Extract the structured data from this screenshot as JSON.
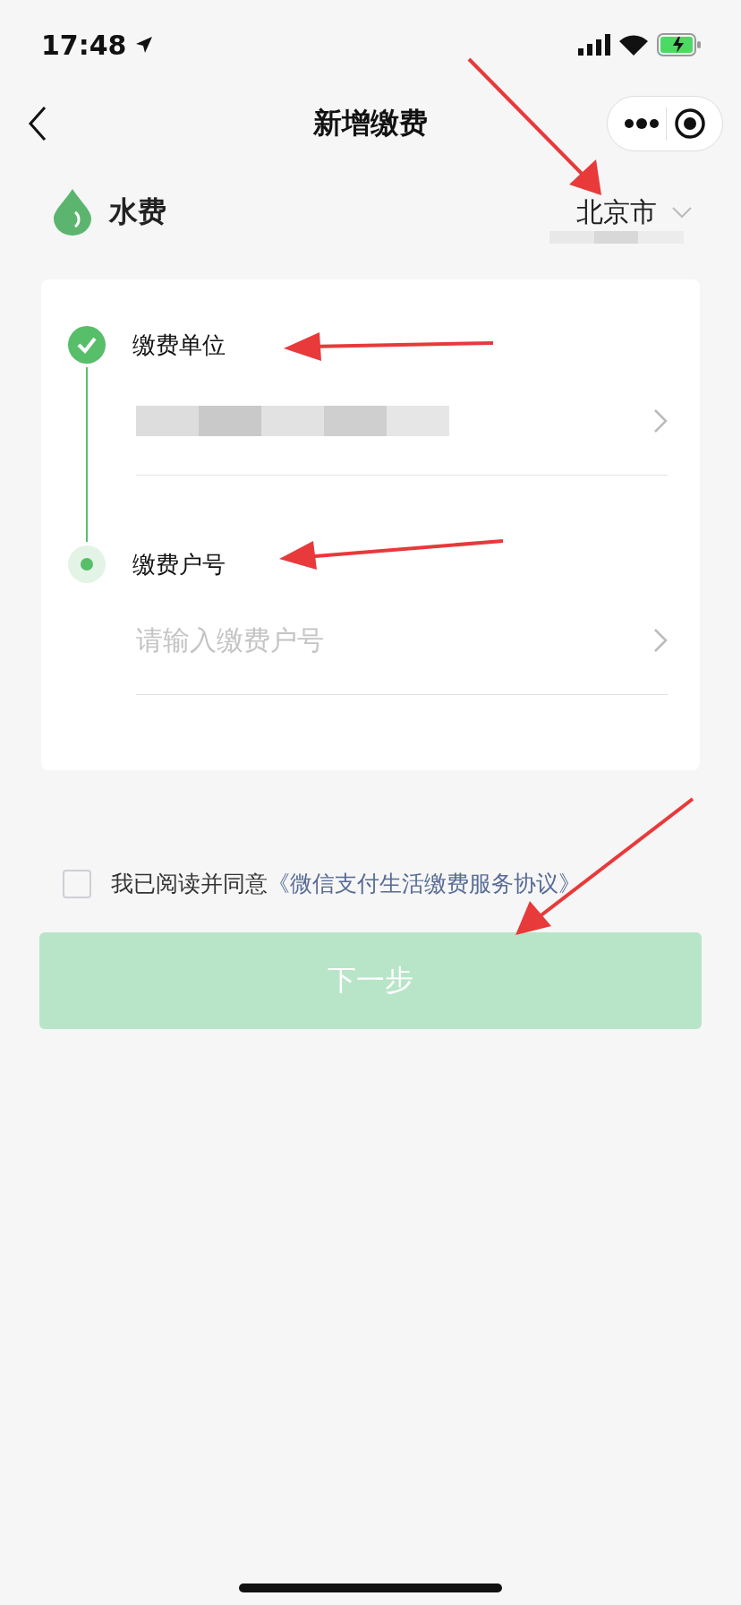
{
  "status_bar": {
    "time": "17:48"
  },
  "nav": {
    "title": "新增缴费"
  },
  "category": {
    "name": "水费",
    "city": "北京市"
  },
  "steps": [
    {
      "title": "缴费单位",
      "done": true,
      "kind": "select"
    },
    {
      "title": "缴费户号",
      "done": false,
      "kind": "input",
      "placeholder": "请输入缴费户号"
    }
  ],
  "agreement": {
    "checked": false,
    "text": "我已阅读并同意",
    "link": "《微信支付生活缴费服务协议》"
  },
  "next_button": {
    "label": "下一步",
    "disabled": true
  }
}
